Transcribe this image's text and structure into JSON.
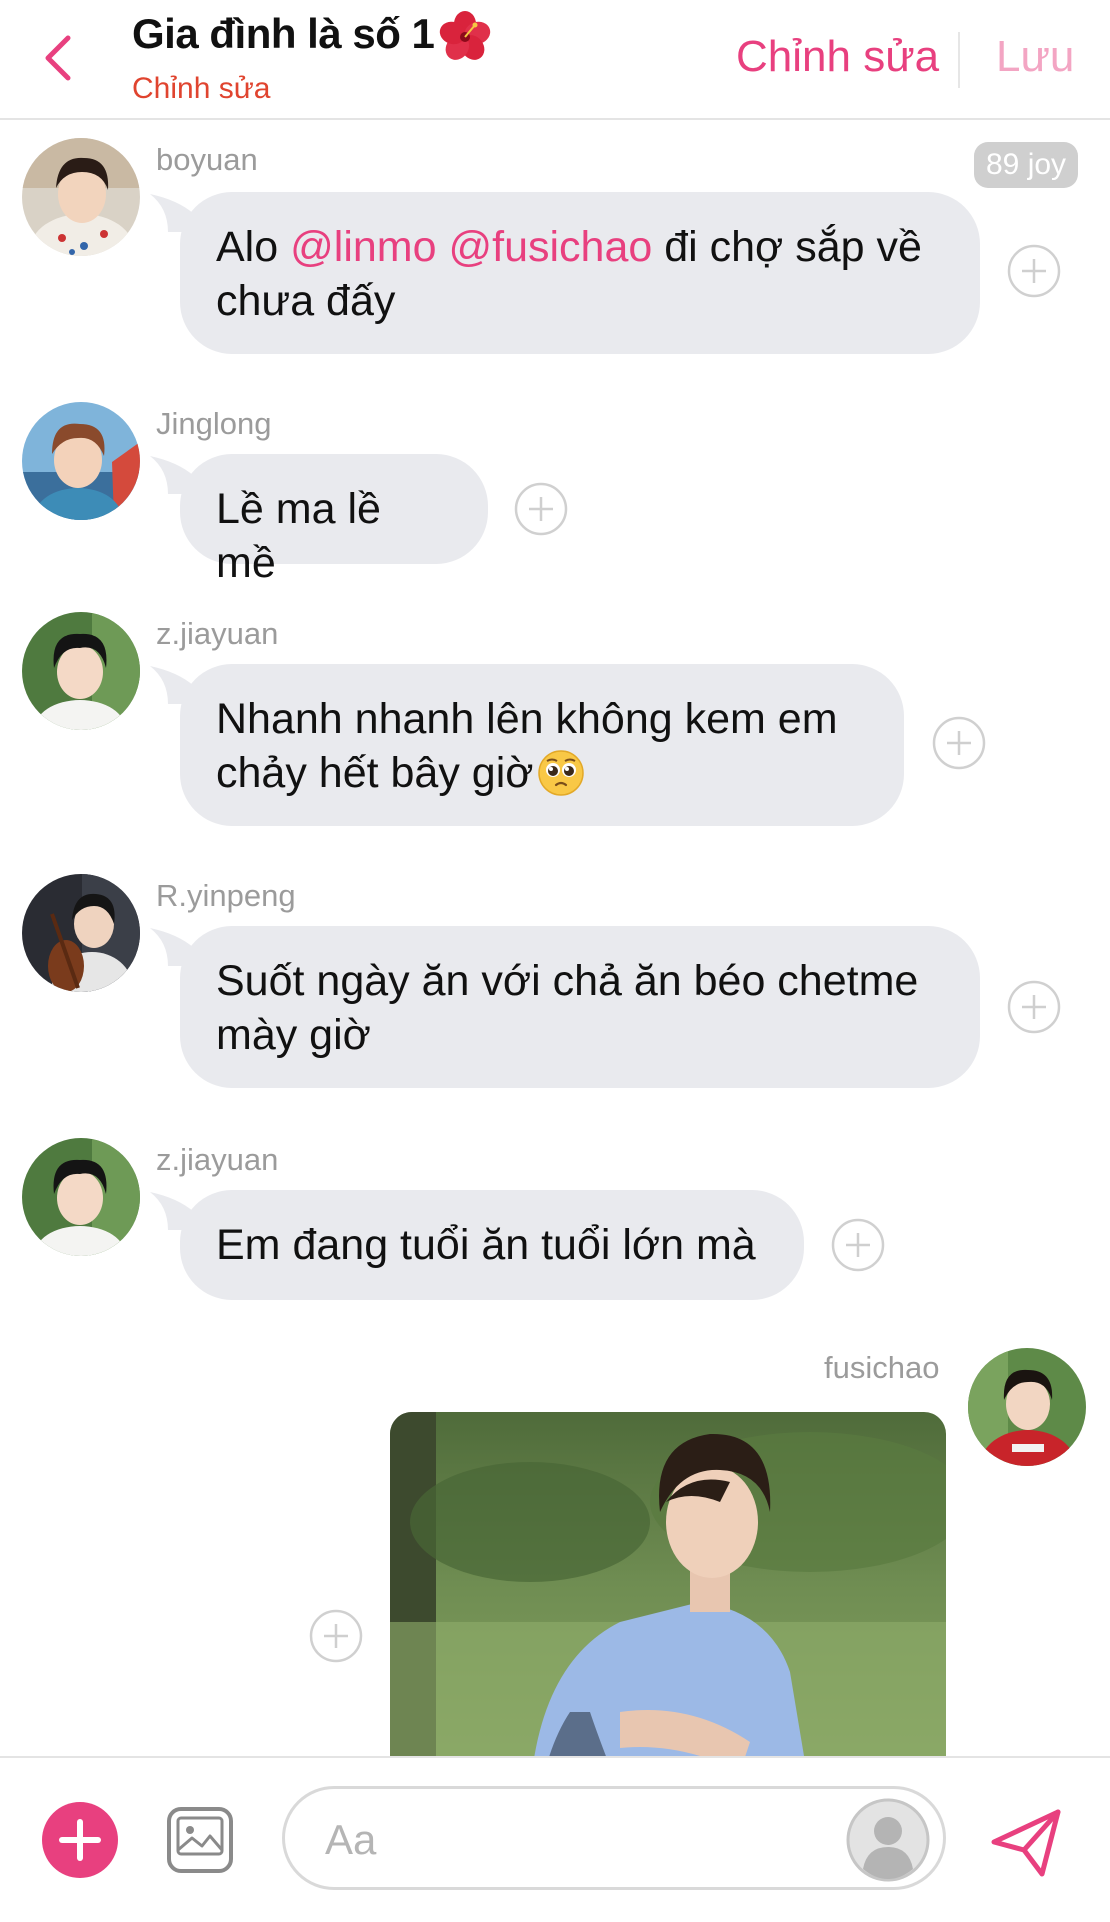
{
  "header": {
    "title": "Gia đình là số 1",
    "title_emoji": "hibiscus-flower",
    "subtitle": "Chỉnh sửa",
    "edit_label": "Chỉnh sửa",
    "save_label": "Lưu"
  },
  "badge": "89 joy",
  "messages": [
    {
      "sender": "boyuan",
      "text_parts": [
        "Alo ",
        "@linmo",
        " ",
        "@fusichao",
        " đi chợ sắp về chưa đấy"
      ]
    },
    {
      "sender": "Jinglong",
      "text": "Lề ma lề mề"
    },
    {
      "sender": "z.jiayuan",
      "text": "Nhanh nhanh lên không kem em chảy hết bây giờ",
      "emoji": "pleading-face"
    },
    {
      "sender": "R.yinpeng",
      "text": "Suốt ngày ăn với chả ăn béo chetme mày giờ"
    },
    {
      "sender": "z.jiayuan",
      "text": "Em đang tuổi ăn tuổi lớn mà"
    },
    {
      "sender": "fusichao",
      "attachment": "photo"
    }
  ],
  "input": {
    "placeholder": "Aa"
  },
  "icons": {
    "back": "chevron-left-icon",
    "react": "plus-circle-icon",
    "add": "plus-icon",
    "gallery": "image-icon",
    "sticker": "avatar-icon",
    "send": "send-icon"
  },
  "colors": {
    "accent": "#e8407f",
    "accent_light": "#f3a5c3",
    "subtitle": "#e0442f",
    "bubble": "#e9eaee"
  }
}
